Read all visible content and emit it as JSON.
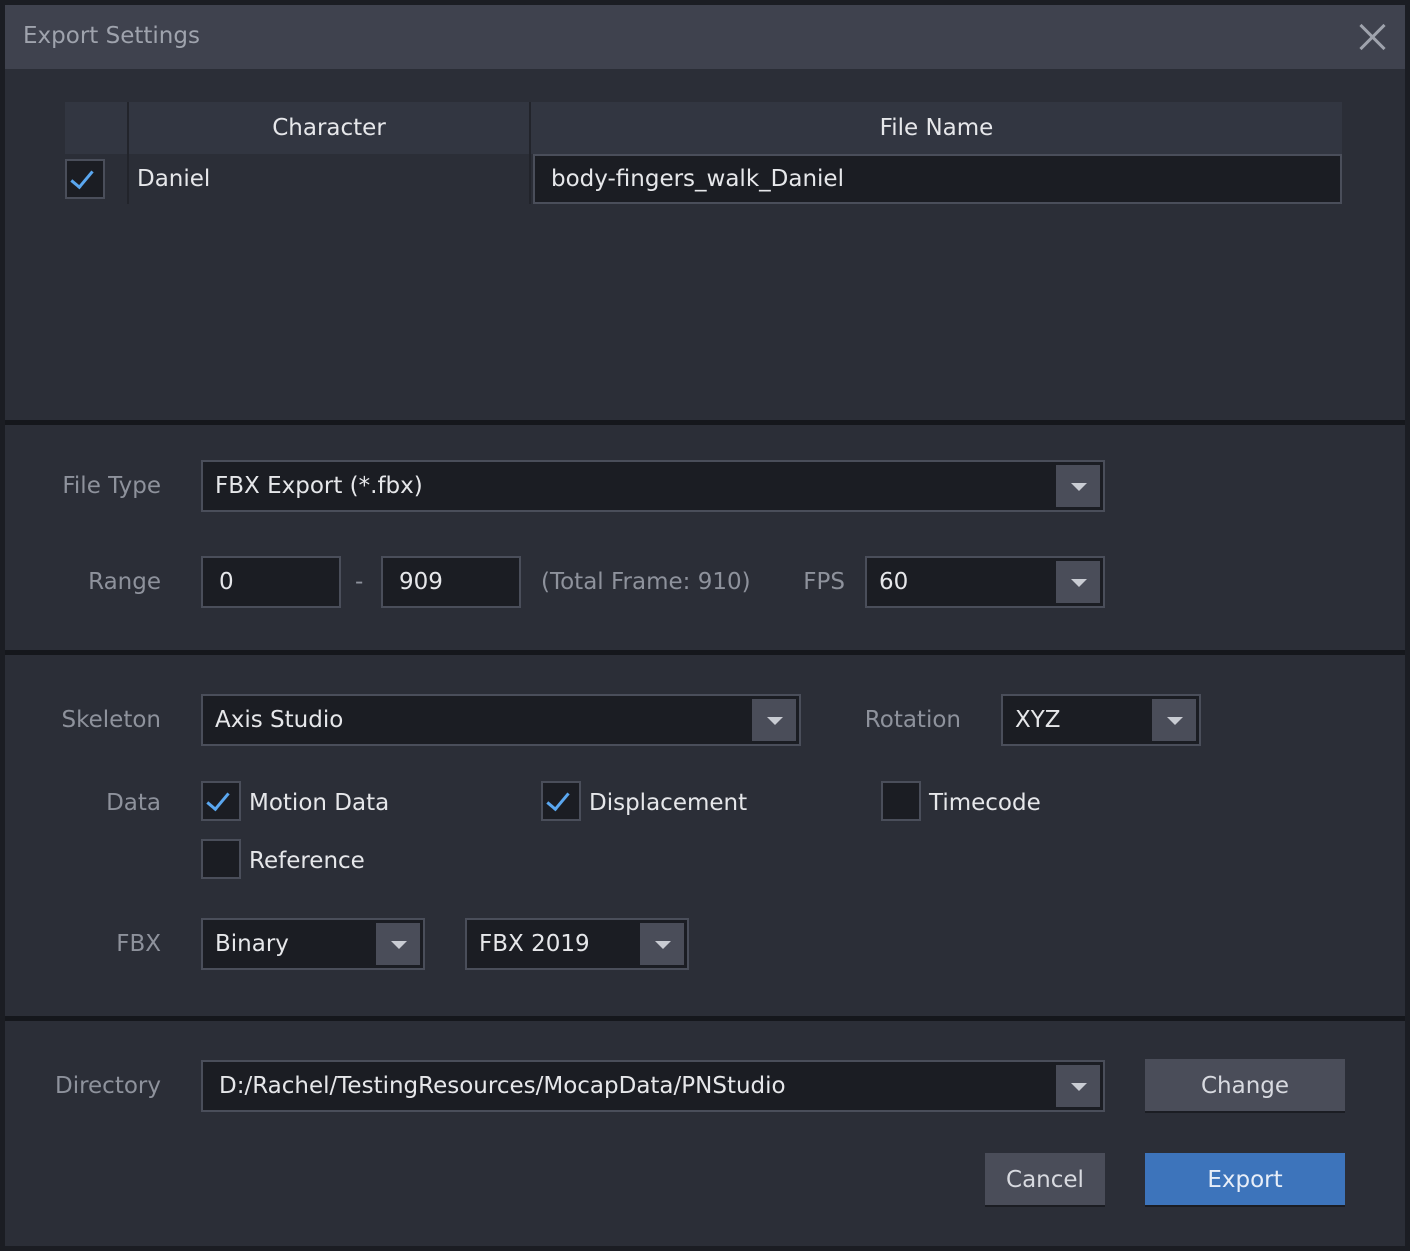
{
  "dialog": {
    "title": "Export Settings"
  },
  "table": {
    "headers": {
      "character": "Character",
      "file_name": "File Name"
    },
    "rows": [
      {
        "checked": true,
        "character": "Daniel",
        "file_name": "body-fingers_walk_Daniel"
      }
    ]
  },
  "file_type": {
    "label": "File Type",
    "value": "FBX Export (*.fbx)"
  },
  "range": {
    "label": "Range",
    "start": "0",
    "separator": "-",
    "end": "909",
    "total_text": "(Total Frame: 910)",
    "fps_label": "FPS",
    "fps_value": "60"
  },
  "skeleton": {
    "label": "Skeleton",
    "value": "Axis Studio",
    "rotation_label": "Rotation",
    "rotation_value": "XYZ"
  },
  "data_options": {
    "label": "Data",
    "motion_data": {
      "label": "Motion Data",
      "checked": true
    },
    "displacement": {
      "label": "Displacement",
      "checked": true
    },
    "timecode": {
      "label": "Timecode",
      "checked": false
    },
    "reference": {
      "label": "Reference",
      "checked": false
    }
  },
  "fbx": {
    "label": "FBX",
    "format": "Binary",
    "version": "FBX 2019"
  },
  "directory": {
    "label": "Directory",
    "value": "D:/Rachel/TestingResources/MocapData/PNStudio",
    "change_label": "Change"
  },
  "actions": {
    "cancel_label": "Cancel",
    "export_label": "Export"
  },
  "colors": {
    "accent": "#3d74bb",
    "check": "#5aa7f0",
    "background": "#2b2e37",
    "titlebar": "#3f424e"
  }
}
